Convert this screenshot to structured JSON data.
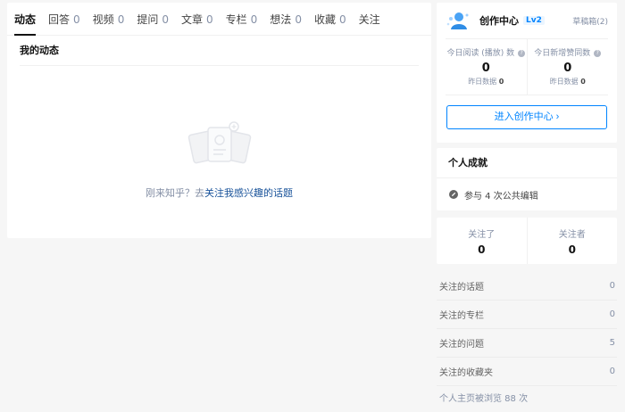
{
  "tabs": [
    {
      "label": "动态",
      "count": ""
    },
    {
      "label": "回答",
      "count": "0"
    },
    {
      "label": "视频",
      "count": "0"
    },
    {
      "label": "提问",
      "count": "0"
    },
    {
      "label": "文章",
      "count": "0"
    },
    {
      "label": "专栏",
      "count": "0"
    },
    {
      "label": "想法",
      "count": "0"
    },
    {
      "label": "收藏",
      "count": "0"
    },
    {
      "label": "关注",
      "count": ""
    }
  ],
  "main": {
    "section_title": "我的动态",
    "empty_prefix": "刚来知乎？去",
    "empty_link": "关注我感兴趣的话题"
  },
  "creator": {
    "title": "创作中心",
    "level": "Lv2",
    "drafts": "草稿箱(2)",
    "stats": [
      {
        "label": "今日阅读 (播放) 数",
        "value": "0",
        "sub_label": "昨日数据",
        "sub_value": "0"
      },
      {
        "label": "今日新增赞同数",
        "value": "0",
        "sub_label": "昨日数据",
        "sub_value": "0"
      }
    ],
    "enter_button": "进入创作中心 ›"
  },
  "achievement": {
    "title": "个人成就",
    "item": "参与 4 次公共编辑"
  },
  "follow": {
    "following_label": "关注了",
    "following_value": "0",
    "followers_label": "关注者",
    "followers_value": "0"
  },
  "links": [
    {
      "label": "关注的话题",
      "value": "0"
    },
    {
      "label": "关注的专栏",
      "value": "0"
    },
    {
      "label": "关注的问题",
      "value": "5"
    },
    {
      "label": "关注的收藏夹",
      "value": "0"
    }
  ],
  "views": "个人主页被浏览 88 次",
  "colors": {
    "accent": "#0084ff",
    "link": "#175199",
    "muted": "#8590a6"
  }
}
